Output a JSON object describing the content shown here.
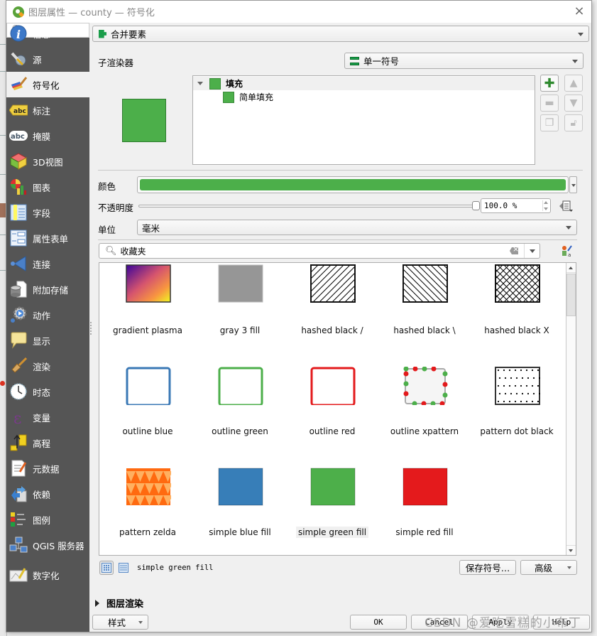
{
  "window": {
    "title": "图层属性 — county — 符号化",
    "close_label": "×"
  },
  "sidebar": {
    "search_placeholder": "",
    "active": "符号化",
    "items": [
      {
        "label": "信息",
        "icon": "info-icon"
      },
      {
        "label": "源",
        "icon": "source-wrench-icon"
      },
      {
        "label": "符号化",
        "icon": "paintbrush-icon"
      },
      {
        "label": "标注",
        "icon": "label-abc-icon"
      },
      {
        "label": "掩膜",
        "icon": "mask-abc-icon"
      },
      {
        "label": "3D视图",
        "icon": "cube-3d-icon"
      },
      {
        "label": "图表",
        "icon": "diagram-chart-icon"
      },
      {
        "label": "字段",
        "icon": "fields-table-icon"
      },
      {
        "label": "属性表单",
        "icon": "attribute-form-icon"
      },
      {
        "label": "连接",
        "icon": "join-icon"
      },
      {
        "label": "附加存储",
        "icon": "auxiliary-storage-icon"
      },
      {
        "label": "动作",
        "icon": "action-gear-icon"
      },
      {
        "label": "显示",
        "icon": "display-speech-bubble-icon"
      },
      {
        "label": "渲染",
        "icon": "rendering-brush-icon"
      },
      {
        "label": "时态",
        "icon": "temporal-clock-icon"
      },
      {
        "label": "变量",
        "icon": "variable-epsilon-icon"
      },
      {
        "label": "高程",
        "icon": "elevation-icon"
      },
      {
        "label": "元数据",
        "icon": "metadata-document-icon"
      },
      {
        "label": "依赖",
        "icon": "dependencies-icon"
      },
      {
        "label": "图例",
        "icon": "legend-icon"
      },
      {
        "label": "QGIS 服务器",
        "icon": "qgis-server-icon"
      },
      {
        "label": "数字化",
        "icon": "digitizing-icon"
      }
    ]
  },
  "renderer": {
    "type_selected": "合并要素",
    "sub_renderer_label": "子渲染器",
    "sub_renderer_selected": "单一符号"
  },
  "symbol_tree": {
    "rows": [
      {
        "label": "填充",
        "level": 0,
        "expanded": true
      },
      {
        "label": "简单填充",
        "level": 1
      }
    ],
    "colors": {
      "fill": "#4caf4a"
    }
  },
  "properties": {
    "color_label": "颜色",
    "color_value": "#4caf4a",
    "opacity_label": "不透明度",
    "opacity_value": "100.0 %",
    "opacity_fraction": 1.0,
    "unit_label": "单位",
    "unit_value": "毫米"
  },
  "library": {
    "search_value": "收藏夹",
    "symbols": [
      {
        "name": "gradient   plasma",
        "kind": "gradient"
      },
      {
        "name": "gray 3 fill",
        "kind": "gray"
      },
      {
        "name": "hashed black /",
        "kind": "hash-fwd"
      },
      {
        "name": "hashed black \\",
        "kind": "hash-back"
      },
      {
        "name": "hashed black X",
        "kind": "hash-x"
      },
      {
        "name": "outline blue",
        "kind": "outline",
        "color": "#3a78b5"
      },
      {
        "name": "outline green",
        "kind": "outline",
        "color": "#4caf4a"
      },
      {
        "name": "outline red",
        "kind": "outline",
        "color": "#e31a1c"
      },
      {
        "name": "outline xpattern",
        "kind": "xpattern"
      },
      {
        "name": "pattern dot black",
        "kind": "dots"
      },
      {
        "name": "pattern zelda",
        "kind": "zelda"
      },
      {
        "name": "simple blue fill",
        "kind": "fill",
        "color": "#377eb8"
      },
      {
        "name": "simple green fill",
        "kind": "fill",
        "color": "#4daf4a",
        "selected": true
      },
      {
        "name": "simple red fill",
        "kind": "fill",
        "color": "#e41a1c"
      }
    ],
    "selected_name": "simple green fill",
    "save_symbol_label": "保存符号…",
    "advanced_label": "高级"
  },
  "layer_rendering": {
    "label": "图层渲染",
    "expanded": false
  },
  "footer": {
    "style_label": "样式",
    "ok_label": "OK",
    "cancel_label": "Cancel",
    "apply_label": "Apply",
    "help_label": "Help"
  },
  "watermark": "CSDN @爱吃雪糕的小布丁"
}
